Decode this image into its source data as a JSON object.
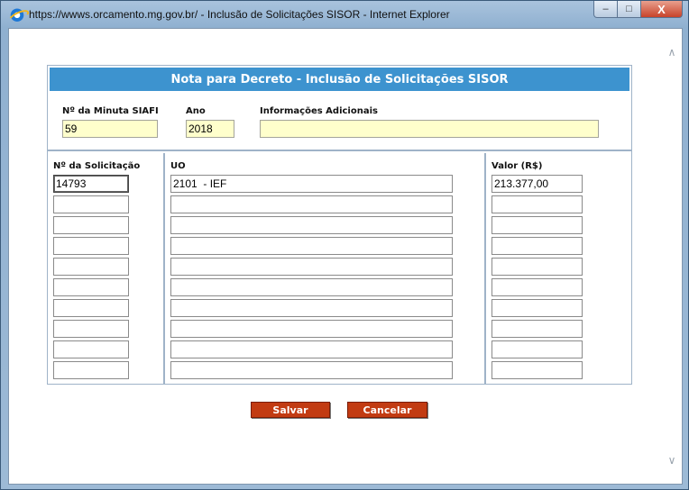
{
  "window": {
    "title": "https://wwws.orcamento.mg.gov.br/ - Inclusão de Solicitações SISOR - Internet Explorer",
    "minimize_glyph": "–",
    "maximize_glyph": "□",
    "close_glyph": "X"
  },
  "form": {
    "header": "Nota para Decreto - Inclusão de Solicitações SISOR",
    "minuta_label": "Nº da Minuta SIAFI",
    "minuta_value": "59",
    "ano_label": "Ano",
    "ano_value": "2018",
    "info_label": "Informações Adicionais",
    "info_value": "",
    "solicitacao_label": "Nº da Solicitação",
    "uo_label": "UO",
    "valor_label": "Valor (R$)",
    "rows": [
      {
        "solicitacao": "14793",
        "uo": "2101  - IEF",
        "valor": "213.377,00"
      },
      {
        "solicitacao": "",
        "uo": "",
        "valor": ""
      },
      {
        "solicitacao": "",
        "uo": "",
        "valor": ""
      },
      {
        "solicitacao": "",
        "uo": "",
        "valor": ""
      },
      {
        "solicitacao": "",
        "uo": "",
        "valor": ""
      },
      {
        "solicitacao": "",
        "uo": "",
        "valor": ""
      },
      {
        "solicitacao": "",
        "uo": "",
        "valor": ""
      },
      {
        "solicitacao": "",
        "uo": "",
        "valor": ""
      },
      {
        "solicitacao": "",
        "uo": "",
        "valor": ""
      },
      {
        "solicitacao": "",
        "uo": "",
        "valor": ""
      }
    ]
  },
  "actions": {
    "save_label": "Salvar",
    "cancel_label": "Cancelar"
  },
  "colors": {
    "header_blue": "#3d93cf",
    "button_red": "#c23b12",
    "field_yellow": "#ffffcc"
  }
}
